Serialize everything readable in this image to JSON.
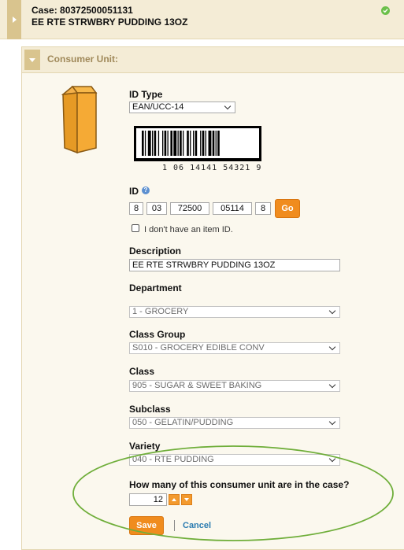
{
  "case": {
    "title": "Case: 80372500051131",
    "subtitle": "EE RTE STRWBRY PUDDING 13OZ",
    "status_color": "#6cc04a"
  },
  "panel": {
    "title": "Consumer Unit:"
  },
  "id_type": {
    "label": "ID Type",
    "value": "EAN/UCC-14"
  },
  "barcode": {
    "text": "1 06 14141 54321 9"
  },
  "id": {
    "label": "ID",
    "segments": [
      "8",
      "03",
      "72500",
      "05114",
      "8"
    ],
    "go_label": "Go",
    "no_id_label": "I don't have an item ID."
  },
  "description": {
    "label": "Description",
    "value": "EE RTE STRWBRY PUDDING 13OZ"
  },
  "department": {
    "label": "Department",
    "value": "1 - GROCERY"
  },
  "class_group": {
    "label": "Class Group",
    "value": "S010 - GROCERY EDIBLE CONV"
  },
  "class": {
    "label": "Class",
    "value": "905 - SUGAR & SWEET BAKING"
  },
  "subclass": {
    "label": "Subclass",
    "value": "050 - GELATIN/PUDDING"
  },
  "variety": {
    "label": "Variety",
    "value": "040 - RTE PUDDING"
  },
  "quantity": {
    "label": "How many of this consumer unit are in the case?",
    "value": "12"
  },
  "actions": {
    "save_label": "Save",
    "cancel_label": "Cancel"
  },
  "colors": {
    "accent_orange": "#f08c1e",
    "header_tan": "#f4ecd6",
    "highlight_green": "#6fae3a"
  }
}
